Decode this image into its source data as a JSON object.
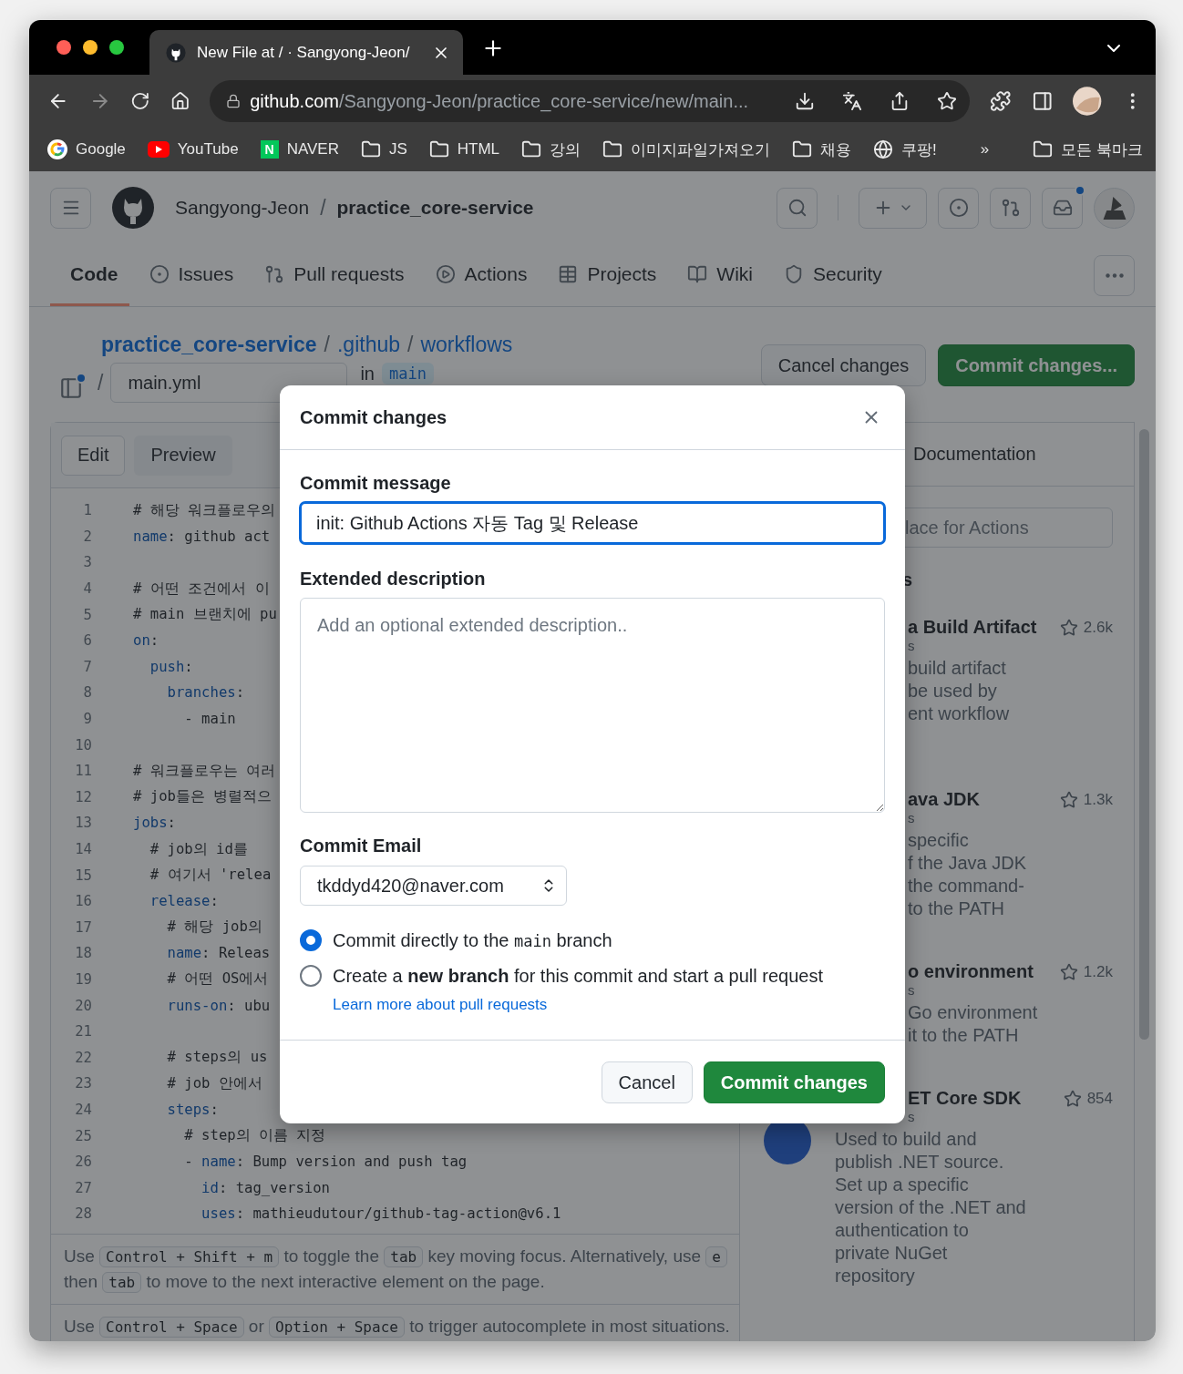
{
  "browser": {
    "tab_title": "New File at / · Sangyong-Jeon/",
    "url_host": "github.com",
    "url_path": "/Sangyong-Jeon/practice_core-service/new/main...",
    "bookmarks": [
      {
        "kind": "google",
        "label": "Google"
      },
      {
        "kind": "youtube",
        "label": "YouTube"
      },
      {
        "kind": "naver",
        "label": "NAVER",
        "badge": "N"
      },
      {
        "kind": "folder",
        "label": "JS"
      },
      {
        "kind": "folder",
        "label": "HTML"
      },
      {
        "kind": "folder",
        "label": "강의"
      },
      {
        "kind": "folder",
        "label": "이미지파일가져오기"
      },
      {
        "kind": "folder",
        "label": "채용"
      },
      {
        "kind": "globe",
        "label": "쿠팡!"
      }
    ],
    "more": "»",
    "all_bookmarks": "모든 북마크"
  },
  "header": {
    "owner": "Sangyong-Jeon",
    "separator": "/",
    "repo": "practice_core-service",
    "inbox_unread": true
  },
  "nav": [
    {
      "kind": "code",
      "label": "Code",
      "selected": true
    },
    {
      "kind": "issues",
      "label": "Issues",
      "selected": false
    },
    {
      "kind": "pulls",
      "label": "Pull requests",
      "selected": false
    },
    {
      "kind": "actions",
      "label": "Actions",
      "selected": false
    },
    {
      "kind": "projects",
      "label": "Projects",
      "selected": false
    },
    {
      "kind": "wiki",
      "label": "Wiki",
      "selected": false
    },
    {
      "kind": "security",
      "label": "Security",
      "selected": false
    }
  ],
  "breadcrumb": {
    "parts": [
      "practice_core-service",
      ".github",
      "workflows"
    ],
    "separator": "/",
    "file_name": "main.yml",
    "in_label": "in",
    "branch": "main"
  },
  "actions": {
    "cancel": "Cancel changes",
    "commit": "Commit changes..."
  },
  "editor": {
    "tabs": [
      {
        "label": "Edit",
        "selected": true
      },
      {
        "label": "Preview",
        "selected": false
      }
    ],
    "lines": [
      {
        "number": "1",
        "segments": [
          {
            "kind": "plain",
            "text": "# 해당 워크플로우의"
          }
        ]
      },
      {
        "number": "2",
        "segments": [
          {
            "kind": "key",
            "text": "name"
          },
          {
            "kind": "plain",
            "text": ": github act"
          }
        ]
      },
      {
        "number": "3"
      },
      {
        "number": "4",
        "segments": [
          {
            "kind": "plain",
            "text": "# 어떤 조건에서 이"
          }
        ]
      },
      {
        "number": "5",
        "segments": [
          {
            "kind": "plain",
            "text": "# main 브랜치에 pu"
          }
        ]
      },
      {
        "number": "6",
        "segments": [
          {
            "kind": "key",
            "text": "on"
          },
          {
            "kind": "plain",
            "text": ":"
          }
        ]
      },
      {
        "number": "7",
        "segments": [
          {
            "kind": "key",
            "text": "  push"
          },
          {
            "kind": "plain",
            "text": ":"
          }
        ]
      },
      {
        "number": "8",
        "segments": [
          {
            "kind": "key",
            "text": "    branches"
          },
          {
            "kind": "plain",
            "text": ":"
          }
        ]
      },
      {
        "number": "9",
        "segments": [
          {
            "kind": "plain",
            "text": "      - main"
          }
        ]
      },
      {
        "number": "10"
      },
      {
        "number": "11",
        "segments": [
          {
            "kind": "plain",
            "text": "# 워크플로우는 여러"
          }
        ]
      },
      {
        "number": "12",
        "segments": [
          {
            "kind": "plain",
            "text": "# job들은 병렬적으"
          }
        ]
      },
      {
        "number": "13",
        "segments": [
          {
            "kind": "key",
            "text": "jobs"
          },
          {
            "kind": "plain",
            "text": ":"
          }
        ]
      },
      {
        "number": "14",
        "segments": [
          {
            "kind": "plain",
            "text": "  # job의 id를"
          }
        ]
      },
      {
        "number": "15",
        "segments": [
          {
            "kind": "plain",
            "text": "  # 여기서 'relea"
          }
        ]
      },
      {
        "number": "16",
        "segments": [
          {
            "kind": "key",
            "text": "  release"
          },
          {
            "kind": "plain",
            "text": ":"
          }
        ]
      },
      {
        "number": "17",
        "segments": [
          {
            "kind": "plain",
            "text": "    # 해당 job의"
          }
        ]
      },
      {
        "number": "18",
        "segments": [
          {
            "kind": "key",
            "text": "    name"
          },
          {
            "kind": "plain",
            "text": ": Releas"
          }
        ]
      },
      {
        "number": "19",
        "segments": [
          {
            "kind": "plain",
            "text": "    # 어떤 OS에서"
          }
        ]
      },
      {
        "number": "20",
        "segments": [
          {
            "kind": "key",
            "text": "    runs-on"
          },
          {
            "kind": "plain",
            "text": ": ubu"
          }
        ]
      },
      {
        "number": "21"
      },
      {
        "number": "22",
        "segments": [
          {
            "kind": "plain",
            "text": "    # steps의 us"
          }
        ]
      },
      {
        "number": "23",
        "segments": [
          {
            "kind": "plain",
            "text": "    # job 안에서"
          }
        ]
      },
      {
        "number": "24",
        "segments": [
          {
            "kind": "key",
            "text": "    steps"
          },
          {
            "kind": "plain",
            "text": ":"
          }
        ]
      },
      {
        "number": "25",
        "segments": [
          {
            "kind": "plain",
            "text": "      # step의 이름 지정"
          }
        ]
      },
      {
        "number": "26",
        "segments": [
          {
            "kind": "plain",
            "text": "      - "
          },
          {
            "kind": "key",
            "text": "name"
          },
          {
            "kind": "plain",
            "text": ": Bump version and push tag"
          }
        ]
      },
      {
        "number": "27",
        "segments": [
          {
            "kind": "key",
            "text": "        id"
          },
          {
            "kind": "plain",
            "text": ": tag_version"
          }
        ]
      },
      {
        "number": "28",
        "segments": [
          {
            "kind": "key",
            "text": "        uses"
          },
          {
            "kind": "plain",
            "text": ": mathieudutour/github-tag-action@v6.1"
          }
        ]
      }
    ],
    "hints": [
      {
        "lines": [
          [
            {
              "kind": "text",
              "text": "Use "
            },
            {
              "kind": "key",
              "text": "Control + Shift + m"
            },
            {
              "kind": "text",
              "text": " to toggle the "
            },
            {
              "kind": "key",
              "text": "tab"
            },
            {
              "kind": "text",
              "text": " key moving focus. Alternatively, use "
            },
            {
              "kind": "key",
              "text": "e"
            }
          ],
          [
            {
              "kind": "text",
              "text": "then "
            },
            {
              "kind": "key",
              "text": "tab"
            },
            {
              "kind": "text",
              "text": " to move to the next interactive element on the page."
            }
          ]
        ]
      },
      {
        "lines": [
          [
            {
              "kind": "text",
              "text": "Use "
            },
            {
              "kind": "key",
              "text": "Control + Space"
            },
            {
              "kind": "text",
              "text": " or "
            },
            {
              "kind": "key",
              "text": "Option + Space"
            },
            {
              "kind": "text",
              "text": " to trigger autocomplete in most situations."
            }
          ]
        ]
      }
    ]
  },
  "docs": {
    "tab": "Documentation",
    "search_placeholder": "lace for Actions",
    "heading": "s",
    "items": [
      {
        "title": "a Build Artifact",
        "byline": "s",
        "star_count": "2.6k",
        "description": [
          "build artifact",
          "be used by",
          "ent workflow"
        ]
      },
      {
        "title": "ava JDK",
        "byline": "s",
        "star_count": "1.3k",
        "description": [
          "specific",
          "f the Java JDK",
          "the command-",
          "to the PATH"
        ]
      },
      {
        "title": "o environment",
        "byline": "s",
        "star_count": "1.2k",
        "description": [
          "Go environment",
          "it to the PATH"
        ]
      },
      {
        "title": "ET Core SDK",
        "byline": "s",
        "star_count": "854",
        "description": [
          "Used to build and",
          "publish .NET source.",
          "Set up a specific",
          "version of the .NET and",
          "authentication to",
          "private NuGet",
          "repository"
        ]
      }
    ]
  },
  "modal": {
    "title": "Commit changes",
    "message_label": "Commit message",
    "message_value": "init: Github Actions 자동 Tag 및 Release",
    "description_label": "Extended description",
    "description_placeholder": "Add an optional extended description..",
    "email_label": "Commit Email",
    "email_value": "tkddyd420@naver.com",
    "options": [
      {
        "selected": true,
        "parts": [
          {
            "kind": "text",
            "text": "Commit directly to the "
          },
          {
            "kind": "code",
            "text": "main"
          },
          {
            "kind": "text",
            "text": " branch"
          }
        ]
      },
      {
        "selected": false,
        "parts": [
          {
            "kind": "text",
            "text": "Create a "
          },
          {
            "kind": "bold",
            "text": "new branch"
          },
          {
            "kind": "text",
            "text": " for this commit and start a pull request"
          }
        ],
        "link": "Learn more about pull requests"
      }
    ],
    "cancel": "Cancel",
    "submit": "Commit changes"
  }
}
